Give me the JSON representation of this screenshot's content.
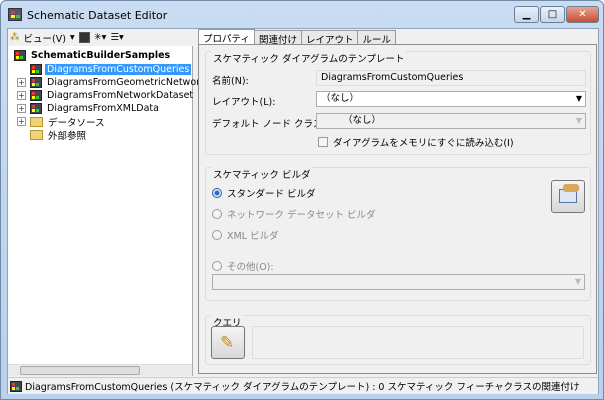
{
  "window": {
    "title": "Schematic Dataset Editor",
    "minimize": "▁",
    "maximize": "□",
    "close": "✕"
  },
  "toolbar": {
    "view_label": "ビュー(V)"
  },
  "tree": {
    "root": "SchematicBuilderSamples",
    "items": [
      {
        "label": "DiagramsFromCustomQueries",
        "type": "dataset",
        "expandable": false,
        "selected": true
      },
      {
        "label": "DiagramsFromGeometricNetwork",
        "type": "dataset",
        "expandable": true
      },
      {
        "label": "DiagramsFromNetworkDataset",
        "type": "dataset",
        "expandable": true
      },
      {
        "label": "DiagramsFromXMLData",
        "type": "dataset",
        "expandable": true
      },
      {
        "label": "データソース",
        "type": "folder",
        "expandable": true
      },
      {
        "label": "外部参照",
        "type": "folder",
        "expandable": false
      }
    ]
  },
  "tabs": [
    "プロパティ",
    "関連付け",
    "レイアウト",
    "ルール"
  ],
  "template": {
    "group": "スケマティック ダイアグラムのテンプレート",
    "name_label": "名前(N):",
    "name_value": "DiagramsFromCustomQueries",
    "layout_label": "レイアウト(L):",
    "layout_value": "（なし）",
    "node_label": "デフォルト ノード クラス(N):",
    "node_value": "（なし）",
    "load_label": "ダイアグラムをメモリにすぐに読み込む(I)",
    "load_checked": false
  },
  "builder": {
    "group": "スケマティック ビルダ",
    "options": [
      {
        "label": "スタンダード ビルダ",
        "checked": true,
        "enabled": true
      },
      {
        "label": "ネットワーク データセット ビルダ",
        "enabled": false
      },
      {
        "label": "XML ビルダ",
        "enabled": false
      },
      {
        "label": "その他(O):",
        "enabled": false
      }
    ],
    "other_value": ""
  },
  "query": {
    "group": "クエリ",
    "value": ""
  },
  "status": "DiagramsFromCustomQueries (スケマティック ダイアグラムのテンプレート) : 0 スケマティック フィーチャクラスの関連付け"
}
